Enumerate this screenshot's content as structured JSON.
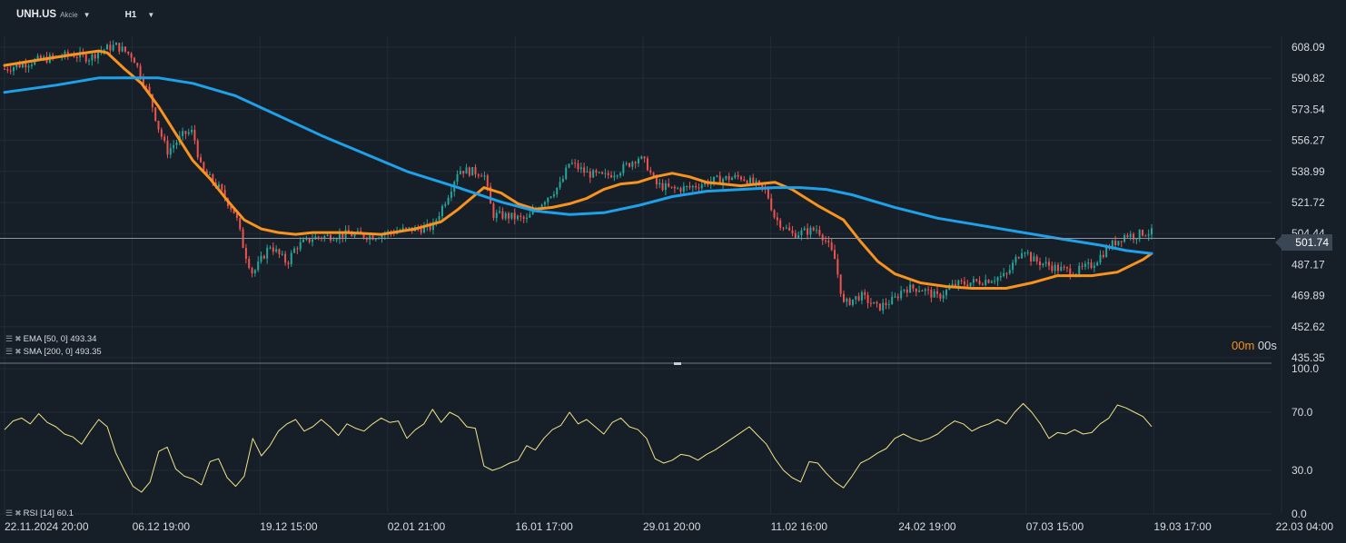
{
  "toolbar": {
    "symbol": "UNH.US",
    "instrument_type": "Akcie",
    "timeframe": "H1"
  },
  "indicators": {
    "ema": "EMA [50, 0] 493.34",
    "sma": "SMA [200, 0] 493.35",
    "rsi": "RSI [14] 60.1"
  },
  "timer": {
    "minutes": "00m",
    "seconds": "00s"
  },
  "colors": {
    "background": "#161e27",
    "ema": "#f7931e",
    "sma": "#1ea1e8",
    "rsi": "#f1e48a",
    "candle_up": "#26a69a",
    "candle_down": "#ef5350"
  },
  "chart_data": [
    {
      "type": "candlestick",
      "symbol": "UNH.US",
      "timeframe": "H1",
      "last_price": 501.74,
      "y_ticks": [
        608.09,
        590.82,
        573.54,
        556.27,
        538.99,
        521.72,
        504.44,
        487.17,
        469.89,
        452.62,
        435.35
      ],
      "ylim": [
        435.35,
        608.09
      ],
      "x_ticks": [
        "22.11.2024 20:00",
        "06.12 19:00",
        "19.12 15:00",
        "02.01 21:00",
        "16.01 17:00",
        "29.01 20:00",
        "11.02 16:00",
        "24.02 19:00",
        "07.03 15:00",
        "19.03 17:00",
        "22.03 04:00"
      ],
      "price_path": [
        [
          0,
          596
        ],
        [
          4,
          601
        ],
        [
          8,
          604
        ],
        [
          10,
          602
        ],
        [
          11,
          606
        ],
        [
          13,
          609
        ],
        [
          15,
          603
        ],
        [
          17,
          580
        ],
        [
          18,
          563
        ],
        [
          19,
          550
        ],
        [
          21,
          560
        ],
        [
          22,
          561
        ],
        [
          23,
          540
        ],
        [
          25,
          530
        ],
        [
          27,
          515
        ],
        [
          28,
          495
        ],
        [
          29,
          482
        ],
        [
          31,
          498
        ],
        [
          33,
          488
        ],
        [
          34,
          497
        ],
        [
          36,
          502
        ],
        [
          40,
          504
        ],
        [
          43,
          503
        ],
        [
          46,
          506
        ],
        [
          50,
          508
        ],
        [
          52,
          528
        ],
        [
          53,
          540
        ],
        [
          56,
          538
        ],
        [
          57,
          515
        ],
        [
          59,
          514
        ],
        [
          61,
          512
        ],
        [
          62,
          518
        ],
        [
          63,
          523
        ],
        [
          65,
          532
        ],
        [
          66,
          544
        ],
        [
          68,
          538
        ],
        [
          70,
          536
        ],
        [
          72,
          540
        ],
        [
          74,
          547
        ],
        [
          75,
          543
        ],
        [
          76,
          532
        ],
        [
          78,
          529
        ],
        [
          80,
          530
        ],
        [
          82,
          533
        ],
        [
          84,
          535
        ],
        [
          86,
          536
        ],
        [
          88,
          531
        ],
        [
          89,
          528
        ],
        [
          90,
          513
        ],
        [
          92,
          504
        ],
        [
          95,
          507
        ],
        [
          96,
          500
        ],
        [
          97,
          490
        ],
        [
          98,
          465
        ],
        [
          100,
          470
        ],
        [
          102,
          463
        ],
        [
          104,
          468
        ],
        [
          105,
          474
        ],
        [
          107,
          474
        ],
        [
          109,
          469
        ],
        [
          111,
          476
        ],
        [
          114,
          478
        ],
        [
          117,
          481
        ],
        [
          119,
          497
        ],
        [
          120,
          490
        ],
        [
          123,
          485
        ],
        [
          125,
          483
        ],
        [
          127,
          487
        ],
        [
          129,
          497
        ],
        [
          131,
          504
        ],
        [
          132,
          503
        ],
        [
          133,
          505
        ]
      ],
      "series": [
        {
          "name": "EMA [50, 0]",
          "last_value": 493.34,
          "points": [
            [
              0,
              598
            ],
            [
              4,
              601
            ],
            [
              8,
              604
            ],
            [
              11,
              606
            ],
            [
              12,
              605
            ],
            [
              14,
              596
            ],
            [
              16,
              588
            ],
            [
              18,
              575
            ],
            [
              20,
              560
            ],
            [
              22,
              545
            ],
            [
              24,
              535
            ],
            [
              26,
              523
            ],
            [
              28,
              512
            ],
            [
              30,
              507
            ],
            [
              32,
              505
            ],
            [
              34,
              504
            ],
            [
              36,
              505
            ],
            [
              40,
              505
            ],
            [
              44,
              504
            ],
            [
              48,
              507
            ],
            [
              51,
              511
            ],
            [
              53,
              518
            ],
            [
              55,
              526
            ],
            [
              56,
              530
            ],
            [
              58,
              527
            ],
            [
              60,
              521
            ],
            [
              62,
              518
            ],
            [
              64,
              519
            ],
            [
              66,
              521
            ],
            [
              68,
              524
            ],
            [
              70,
              529
            ],
            [
              72,
              532
            ],
            [
              74,
              533
            ],
            [
              76,
              536
            ],
            [
              78,
              538
            ],
            [
              80,
              536
            ],
            [
              82,
              533
            ],
            [
              86,
              531
            ],
            [
              88,
              532
            ],
            [
              90,
              533
            ],
            [
              92,
              529
            ],
            [
              95,
              520
            ],
            [
              98,
              512
            ],
            [
              100,
              500
            ],
            [
              102,
              489
            ],
            [
              104,
              482
            ],
            [
              107,
              477
            ],
            [
              110,
              475
            ],
            [
              113,
              474
            ],
            [
              117,
              474
            ],
            [
              120,
              477
            ],
            [
              123,
              481
            ],
            [
              127,
              481
            ],
            [
              130,
              483
            ],
            [
              133,
              490
            ],
            [
              134,
              493.34
            ]
          ]
        },
        {
          "name": "SMA [200, 0]",
          "last_value": 493.35,
          "points": [
            [
              0,
              583
            ],
            [
              6,
              587
            ],
            [
              11,
              591
            ],
            [
              15,
              591
            ],
            [
              18,
              591
            ],
            [
              22,
              588
            ],
            [
              27,
              581
            ],
            [
              32,
              570
            ],
            [
              37,
              559
            ],
            [
              42,
              549
            ],
            [
              47,
              539
            ],
            [
              53,
              530
            ],
            [
              58,
              522
            ],
            [
              62,
              517
            ],
            [
              66,
              515
            ],
            [
              70,
              516
            ],
            [
              74,
              520
            ],
            [
              78,
              525
            ],
            [
              82,
              528
            ],
            [
              86,
              529
            ],
            [
              90,
              530
            ],
            [
              93,
              530
            ],
            [
              96,
              529
            ],
            [
              99,
              526
            ],
            [
              104,
              519
            ],
            [
              109,
              513
            ],
            [
              114,
              509
            ],
            [
              119,
              505
            ],
            [
              124,
              501
            ],
            [
              128,
              498
            ],
            [
              131,
              495
            ],
            [
              134,
              493.35
            ]
          ]
        }
      ]
    },
    {
      "type": "line",
      "name": "RSI [14]",
      "last_value": 60.1,
      "y_ticks": [
        100.0,
        70.0,
        30.0,
        0.0
      ],
      "ylim": [
        0,
        100
      ],
      "points": [
        [
          0,
          58
        ],
        [
          1,
          64
        ],
        [
          2,
          66
        ],
        [
          3,
          62
        ],
        [
          4,
          69
        ],
        [
          5,
          63
        ],
        [
          6,
          60
        ],
        [
          7,
          55
        ],
        [
          8,
          53
        ],
        [
          9,
          48
        ],
        [
          10,
          57
        ],
        [
          11,
          65
        ],
        [
          12,
          60
        ],
        [
          13,
          42
        ],
        [
          14,
          30
        ],
        [
          15,
          19
        ],
        [
          16,
          15
        ],
        [
          17,
          22
        ],
        [
          18,
          43
        ],
        [
          19,
          46
        ],
        [
          20,
          31
        ],
        [
          21,
          26
        ],
        [
          22,
          24
        ],
        [
          23,
          20
        ],
        [
          24,
          36
        ],
        [
          25,
          38
        ],
        [
          26,
          25
        ],
        [
          27,
          19
        ],
        [
          28,
          26
        ],
        [
          29,
          52
        ],
        [
          30,
          40
        ],
        [
          31,
          47
        ],
        [
          32,
          57
        ],
        [
          33,
          62
        ],
        [
          34,
          65
        ],
        [
          35,
          57
        ],
        [
          36,
          60
        ],
        [
          37,
          65
        ],
        [
          38,
          60
        ],
        [
          39,
          54
        ],
        [
          40,
          62
        ],
        [
          41,
          59
        ],
        [
          42,
          57
        ],
        [
          43,
          62
        ],
        [
          44,
          66
        ],
        [
          45,
          63
        ],
        [
          46,
          64
        ],
        [
          47,
          52
        ],
        [
          48,
          58
        ],
        [
          49,
          62
        ],
        [
          50,
          72
        ],
        [
          51,
          63
        ],
        [
          52,
          70
        ],
        [
          53,
          67
        ],
        [
          54,
          60
        ],
        [
          55,
          59
        ],
        [
          56,
          33
        ],
        [
          57,
          30
        ],
        [
          58,
          32
        ],
        [
          59,
          35
        ],
        [
          60,
          37
        ],
        [
          61,
          47
        ],
        [
          62,
          44
        ],
        [
          63,
          52
        ],
        [
          64,
          58
        ],
        [
          65,
          61
        ],
        [
          66,
          70
        ],
        [
          67,
          62
        ],
        [
          68,
          65
        ],
        [
          69,
          60
        ],
        [
          70,
          55
        ],
        [
          71,
          63
        ],
        [
          72,
          66
        ],
        [
          73,
          60
        ],
        [
          74,
          58
        ],
        [
          75,
          52
        ],
        [
          76,
          38
        ],
        [
          77,
          35
        ],
        [
          78,
          37
        ],
        [
          79,
          41
        ],
        [
          80,
          40
        ],
        [
          81,
          37
        ],
        [
          82,
          41
        ],
        [
          83,
          44
        ],
        [
          84,
          48
        ],
        [
          85,
          52
        ],
        [
          86,
          56
        ],
        [
          87,
          60
        ],
        [
          88,
          54
        ],
        [
          89,
          48
        ],
        [
          90,
          38
        ],
        [
          91,
          30
        ],
        [
          92,
          25
        ],
        [
          93,
          22
        ],
        [
          94,
          36
        ],
        [
          95,
          35
        ],
        [
          96,
          28
        ],
        [
          97,
          22
        ],
        [
          98,
          18
        ],
        [
          99,
          26
        ],
        [
          100,
          35
        ],
        [
          101,
          38
        ],
        [
          102,
          42
        ],
        [
          103,
          45
        ],
        [
          104,
          52
        ],
        [
          105,
          55
        ],
        [
          106,
          52
        ],
        [
          107,
          50
        ],
        [
          108,
          52
        ],
        [
          109,
          55
        ],
        [
          110,
          60
        ],
        [
          111,
          64
        ],
        [
          112,
          62
        ],
        [
          113,
          57
        ],
        [
          114,
          60
        ],
        [
          115,
          62
        ],
        [
          116,
          65
        ],
        [
          117,
          62
        ],
        [
          118,
          70
        ],
        [
          119,
          76
        ],
        [
          120,
          70
        ],
        [
          121,
          62
        ],
        [
          122,
          52
        ],
        [
          123,
          56
        ],
        [
          124,
          55
        ],
        [
          125,
          58
        ],
        [
          126,
          55
        ],
        [
          127,
          56
        ],
        [
          128,
          62
        ],
        [
          129,
          66
        ],
        [
          130,
          75
        ],
        [
          131,
          73
        ],
        [
          132,
          70
        ],
        [
          133,
          67
        ],
        [
          134,
          60.1
        ]
      ]
    }
  ]
}
